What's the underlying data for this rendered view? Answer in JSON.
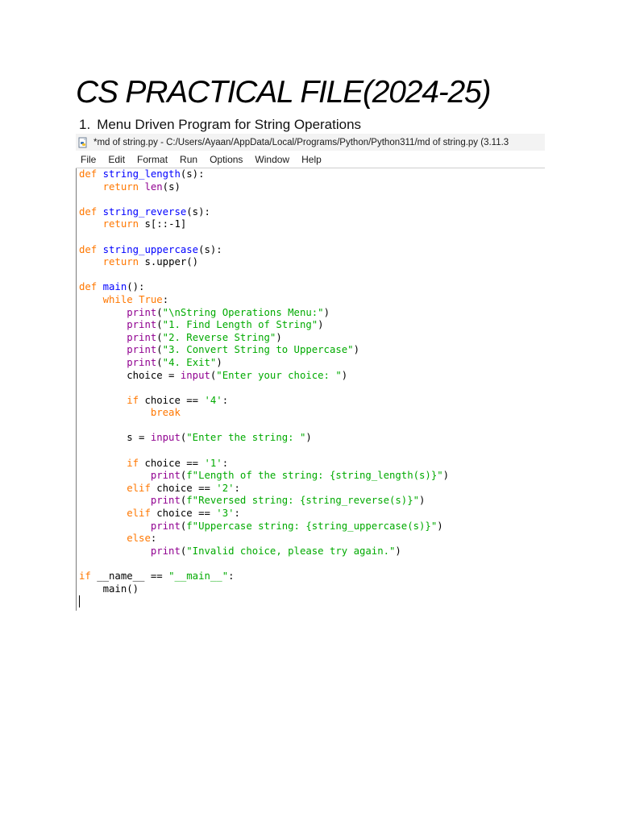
{
  "document": {
    "title": "CS PRACTICAL FILE(2024-25)",
    "item": {
      "number": "1.",
      "heading": "Menu Driven Program for String Operations"
    }
  },
  "idle_window": {
    "title": "*md of string.py - C:/Users/Ayaan/AppData/Local/Programs/Python/Python311/md of string.py (3.11.3",
    "icon": "python-file-icon",
    "menu": [
      "File",
      "Edit",
      "Format",
      "Run",
      "Options",
      "Window",
      "Help"
    ],
    "syntax_colors": {
      "keyword": "#ff7700",
      "definition": "#0000ff",
      "builtin": "#900090",
      "string": "#00aa00",
      "default": "#000000"
    },
    "code_lines": [
      "def string_length(s):",
      "    return len(s)",
      "",
      "def string_reverse(s):",
      "    return s[::-1]",
      "",
      "def string_uppercase(s):",
      "    return s.upper()",
      "",
      "def main():",
      "    while True:",
      "        print(\"\\nString Operations Menu:\")",
      "        print(\"1. Find Length of String\")",
      "        print(\"2. Reverse String\")",
      "        print(\"3. Convert String to Uppercase\")",
      "        print(\"4. Exit\")",
      "        choice = input(\"Enter your choice: \")",
      "",
      "        if choice == '4':",
      "            break",
      "",
      "        s = input(\"Enter the string: \")",
      "",
      "        if choice == '1':",
      "            print(f\"Length of the string: {string_length(s)}\")",
      "        elif choice == '2':",
      "            print(f\"Reversed string: {string_reverse(s)}\")",
      "        elif choice == '3':",
      "            print(f\"Uppercase string: {string_uppercase(s)}\")",
      "        else:",
      "            print(\"Invalid choice, please try again.\")",
      "",
      "if __name__ == \"__main__\":",
      "    main()"
    ]
  }
}
